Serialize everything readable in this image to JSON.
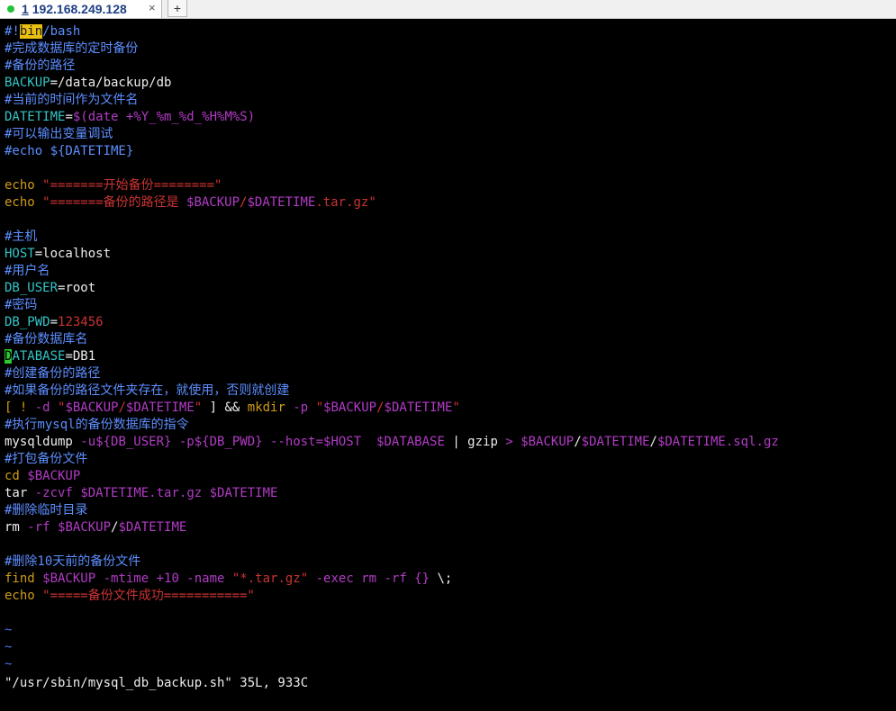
{
  "tab": {
    "number": "1",
    "host": "192.168.249.128",
    "close_symbol": "×",
    "add_symbol": "+"
  },
  "colors": {
    "comment": "#5d8eff",
    "variable": "#34c3c6",
    "string": "#cc3333",
    "keyword": "#cf9c18",
    "option": "#b23bc6",
    "cursor": "#2fc82f",
    "search_highlight": "#e8c010"
  },
  "code": {
    "l1_a": "#!",
    "l1_b": "bin",
    "l1_c": "/bash",
    "l2": "#完成数据库的定时备份",
    "l3": "#备份的路径",
    "l4_a": "BACKUP",
    "l4_b": "=/data/backup/db",
    "l5": "#当前的时间作为文件名",
    "l6_a": "DATETIME",
    "l6_b": "=",
    "l6_c": "$(date +%Y_%m_%d_%H%M%S)",
    "l7": "#可以输出变量调试",
    "l8": "#echo ${DATETIME}",
    "l10_a": "echo",
    "l10_b": " \"=======开始备份========\"",
    "l11_a": "echo",
    "l11_b": " \"=======备份的路径是 ",
    "l11_c": "$BACKUP",
    "l11_d": "/",
    "l11_e": "$DATETIME",
    "l11_f": ".tar.gz\"",
    "l13": "#主机",
    "l14_a": "HOST",
    "l14_b": "=localhost",
    "l15": "#用户名",
    "l16_a": "DB_USER",
    "l16_b": "=root",
    "l17": "#密码",
    "l18_a": "DB_PWD",
    "l18_b": "=",
    "l18_c": "123456",
    "l19": "#备份数据库名",
    "l20_a": "D",
    "l20_b": "ATABASE",
    "l20_c": "=DB1",
    "l21": "#创建备份的路径",
    "l22": "#如果备份的路径文件夹存在，就使用，否则就创建",
    "l23_a": "[ ! ",
    "l23_b": "-d",
    "l23_c": " \"",
    "l23_d": "$BACKUP",
    "l23_e": "/",
    "l23_f": "$DATETIME",
    "l23_g": "\"",
    "l23_h": " ] && ",
    "l23_i": "mkdir",
    "l23_j": " -p",
    "l23_k": " \"",
    "l23_l": "$BACKUP",
    "l23_m": "/",
    "l23_n": "$DATETIME",
    "l23_o": "\"",
    "l24": "#执行mysql的备份数据库的指令",
    "l25_a": "mysqldump ",
    "l25_b": "-u${DB_USER} -p${DB_PWD} --host=$HOST",
    "l25_c": "  ",
    "l25_d": "$DATABASE",
    "l25_e": " | gzip ",
    "l25_f": ">",
    "l25_g": " ",
    "l25_h": "$BACKUP",
    "l25_i": "/",
    "l25_j": "$DATETIME",
    "l25_k": "/",
    "l25_l": "$DATETIME",
    "l25_m": ".sql.gz",
    "l26": "#打包备份文件",
    "l27_a": "cd",
    "l27_b": " $BACKUP",
    "l28_a": "tar ",
    "l28_b": "-zcvf",
    "l28_c": " ",
    "l28_d": "$DATETIME",
    "l28_e": ".tar.gz ",
    "l28_f": "$DATETIME",
    "l29": "#删除临时目录",
    "l30_a": "rm ",
    "l30_b": "-rf",
    "l30_c": " ",
    "l30_d": "$BACKUP",
    "l30_e": "/",
    "l30_f": "$DATETIME",
    "l32": "#删除10天前的备份文件",
    "l33_a": "find",
    "l33_b": " $BACKUP",
    "l33_c": " -mtime +10 -name ",
    "l33_d": "\"*.tar.gz\"",
    "l33_e": " -exec rm -rf {} ",
    "l33_f": "\\;",
    "l34_a": "echo",
    "l34_b": " \"=====备份文件成功===========\"",
    "tilde": "~"
  },
  "status_line": "\"/usr/sbin/mysql_db_backup.sh\" 35L, 933C"
}
